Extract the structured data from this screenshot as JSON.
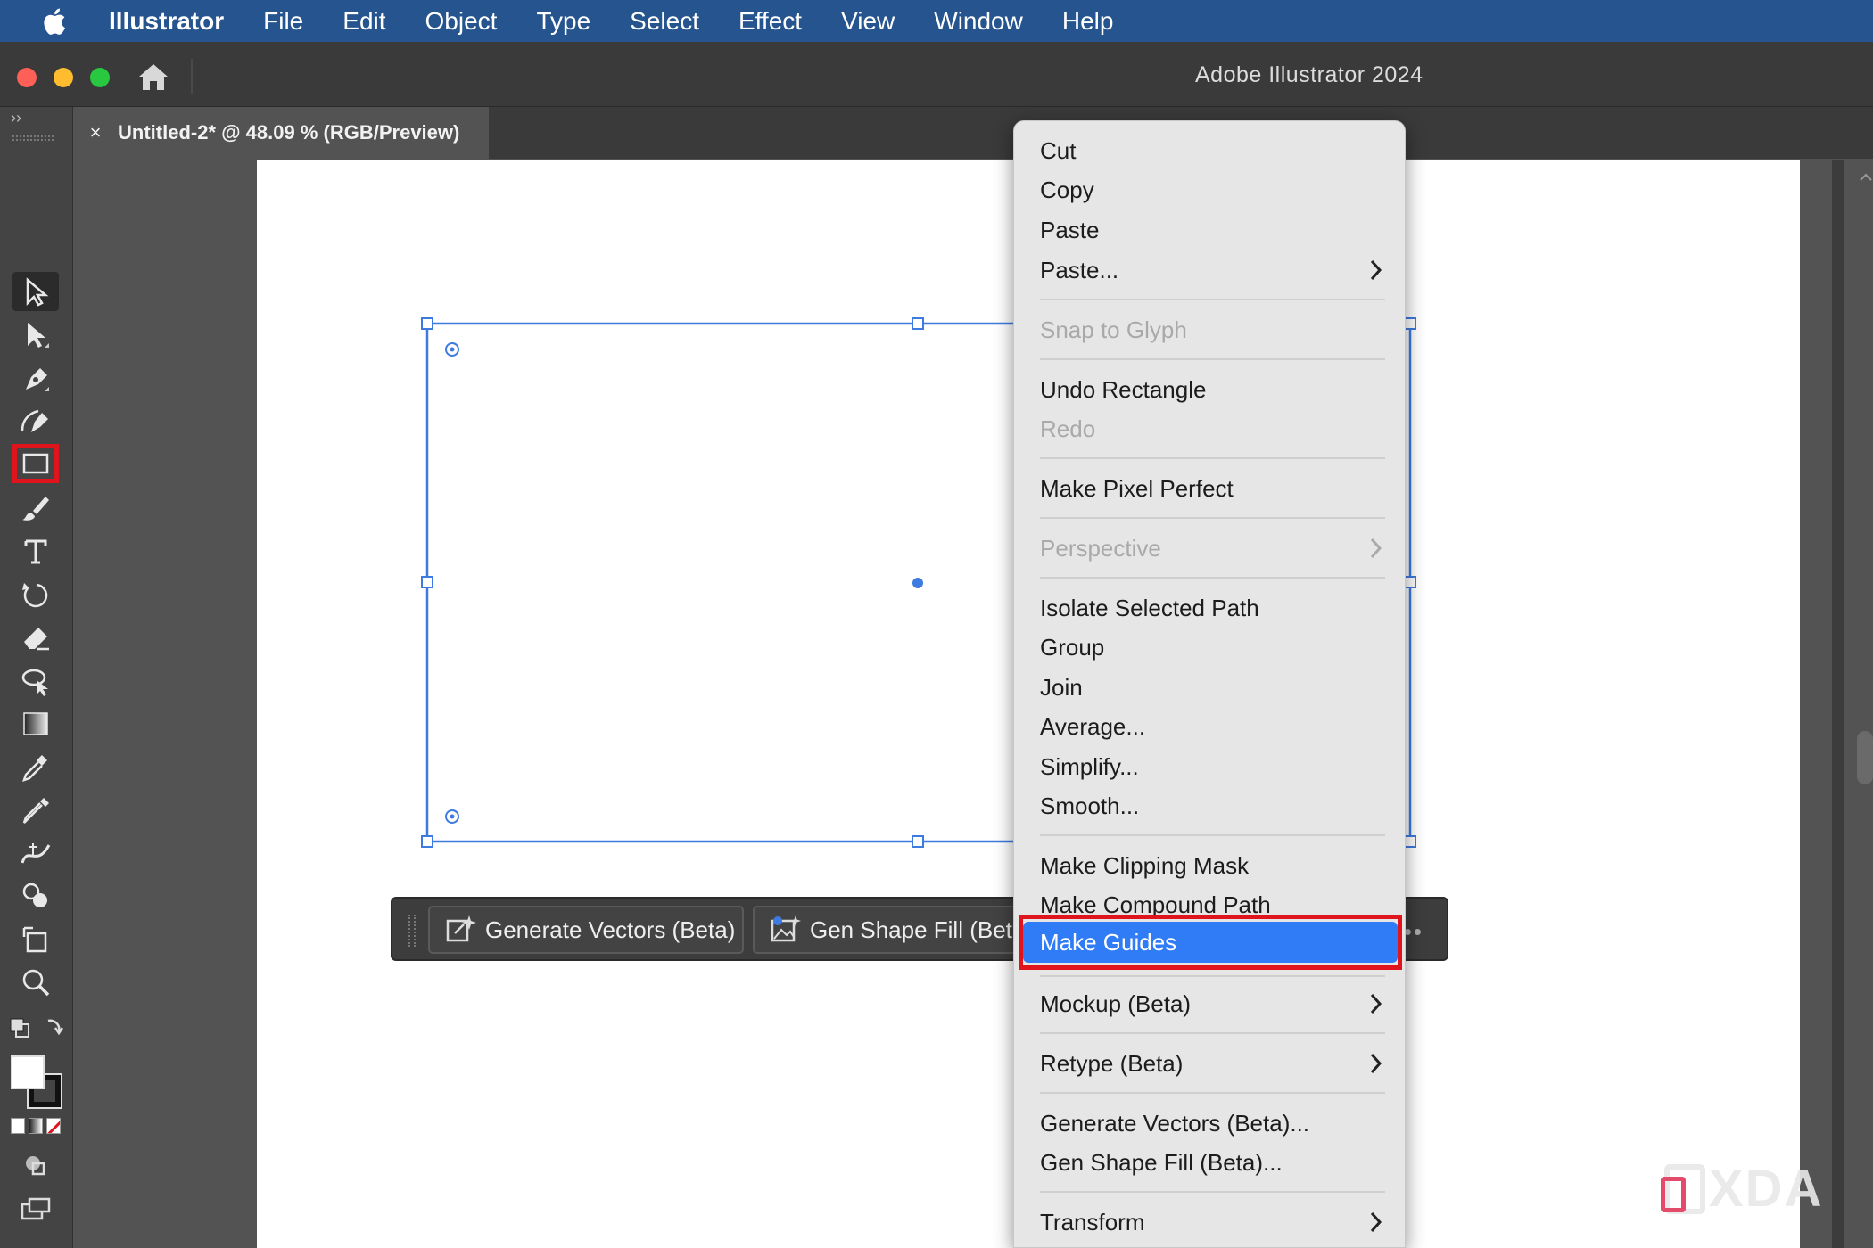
{
  "menubar": {
    "apple_icon": "apple-icon",
    "items": [
      "Illustrator",
      "File",
      "Edit",
      "Object",
      "Type",
      "Select",
      "Effect",
      "View",
      "Window",
      "Help"
    ]
  },
  "window": {
    "title": "Adobe Illustrator 2024",
    "traffic_lights": [
      "#fe5f57",
      "#febc2e",
      "#28c840"
    ]
  },
  "document_tab": {
    "close_glyph": "×",
    "title": "Untitled-2* @ 48.09 % (RGB/Preview)"
  },
  "toolbar": {
    "collapse_glyph": "››",
    "tools": [
      "selection-tool-icon",
      "direct-selection-tool-icon",
      "pen-tool-icon",
      "curvature-tool-icon",
      "rectangle-tool-icon",
      "paintbrush-tool-icon",
      "type-tool-icon",
      "rotate-tool-icon",
      "eraser-tool-icon",
      "lasso-tool-icon",
      "gradient-tool-icon",
      "eyedropper-tool-icon",
      "blend-tool-icon",
      "width-tool-icon",
      "shape-builder-tool-icon",
      "artboard-tool-icon",
      "zoom-tool-icon",
      "swap-fill-stroke-icon",
      "fill-stroke-swatches",
      "color-mode-icons",
      "draw-mode-icon",
      "screen-mode-icon",
      "more-tools-icon"
    ],
    "active_tool": "rectangle-tool-icon",
    "more_glyph": "•••"
  },
  "taskbar": {
    "buttons": [
      "Generate Vectors (Beta)",
      "Gen Shape Fill (Beta"
    ],
    "more_glyph": "••"
  },
  "context_menu": {
    "items": [
      {
        "label": "Cut",
        "enabled": true
      },
      {
        "label": "Copy",
        "enabled": true
      },
      {
        "label": "Paste",
        "enabled": true
      },
      {
        "label": "Paste...",
        "enabled": true,
        "submenu": true
      },
      {
        "label": "Snap to Glyph",
        "enabled": false
      },
      {
        "label": "Undo Rectangle",
        "enabled": true
      },
      {
        "label": "Redo",
        "enabled": false
      },
      {
        "label": "Make Pixel Perfect",
        "enabled": true
      },
      {
        "label": "Perspective",
        "enabled": false,
        "submenu": true
      },
      {
        "label": "Isolate Selected Path",
        "enabled": true
      },
      {
        "label": "Group",
        "enabled": true
      },
      {
        "label": "Join",
        "enabled": true
      },
      {
        "label": "Average...",
        "enabled": true
      },
      {
        "label": "Simplify...",
        "enabled": true
      },
      {
        "label": "Smooth...",
        "enabled": true
      },
      {
        "label": "Make Clipping Mask",
        "enabled": true
      },
      {
        "label": "Make Compound Path",
        "enabled": true
      },
      {
        "label": "Make Guides",
        "enabled": true,
        "highlighted": true
      },
      {
        "label": "Mockup (Beta)",
        "enabled": true,
        "submenu": true
      },
      {
        "label": "Retype (Beta)",
        "enabled": true,
        "submenu": true
      },
      {
        "label": "Generate Vectors (Beta)...",
        "enabled": true
      },
      {
        "label": "Gen Shape Fill (Beta)...",
        "enabled": true
      },
      {
        "label": "Transform",
        "enabled": true,
        "submenu": true
      }
    ]
  },
  "watermark": "XDA",
  "colors": {
    "menubar": "#25548e",
    "selection": "#3d7be0",
    "highlight": "#2f7cf6",
    "callout": "#e0141c"
  }
}
